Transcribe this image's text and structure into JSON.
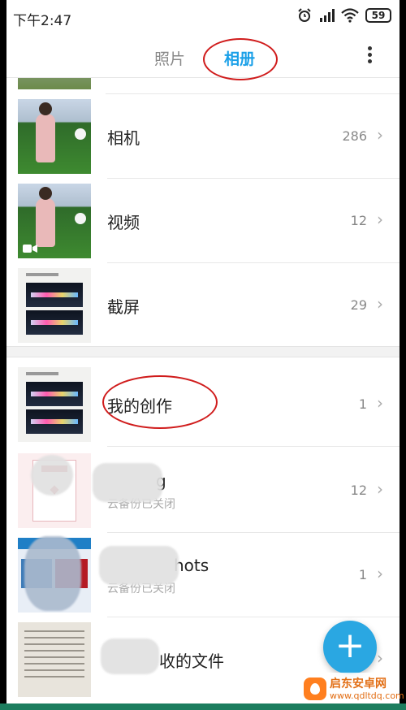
{
  "status_bar": {
    "time": "下午2:47",
    "battery": "59"
  },
  "header": {
    "tabs": [
      {
        "label": "照片",
        "active": false
      },
      {
        "label": "相册",
        "active": true
      }
    ],
    "accent_color": "#1aa0e8"
  },
  "albums": [
    {
      "name": "相机",
      "count": "286"
    },
    {
      "name": "视频",
      "count": "12"
    },
    {
      "name": "截屏",
      "count": "29"
    },
    {
      "name": "我的创作",
      "count": "1"
    },
    {
      "name": "g",
      "subtitle": "云备份已关闭",
      "count": "12"
    },
    {
      "name": "hots",
      "subtitle": "云备份已关闭",
      "count": "1"
    },
    {
      "name": "收的文件",
      "count": ""
    }
  ],
  "fab": {
    "label": "+"
  },
  "watermark": {
    "title": "启东安卓网",
    "url": "www.qdltdq.com"
  }
}
